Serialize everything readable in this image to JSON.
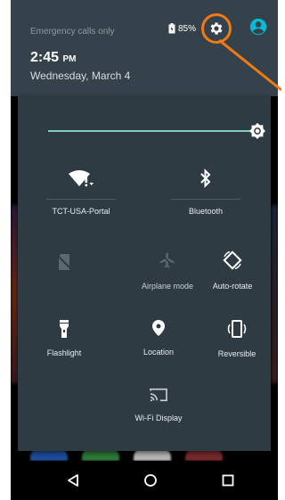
{
  "status_bar": {
    "carrier_status": "Emergency calls only",
    "battery_percent": "85%",
    "time": "2:45",
    "time_period": "PM",
    "date": "Wednesday, March 4"
  },
  "brightness": {
    "level": 0.97
  },
  "tiles": {
    "wifi": {
      "label": "TCT-USA-Portal"
    },
    "bluetooth": {
      "label": "Bluetooth"
    },
    "airplane": {
      "label": "Airplane mode"
    },
    "autorotate": {
      "label": "Auto-rotate"
    },
    "flashlight": {
      "label": "Flashlight"
    },
    "location": {
      "label": "Location"
    },
    "reversible": {
      "label": "Reversible"
    },
    "cast": {
      "label": "Wi-Fi Display"
    }
  },
  "colors": {
    "header_bg": "#36424b",
    "panel_bg": "#2f3b43",
    "accent": "#80cbc4",
    "highlight": "#f07a14",
    "avatar": "#00bcd4"
  },
  "icons": [
    "battery-icon",
    "gear-icon",
    "account-icon",
    "wifi-icon",
    "bluetooth-icon",
    "sim-off-icon",
    "airplane-icon",
    "autorotate-icon",
    "flashlight-icon",
    "location-icon",
    "reversible-icon",
    "cast-icon",
    "back-icon",
    "home-icon",
    "recents-icon"
  ]
}
